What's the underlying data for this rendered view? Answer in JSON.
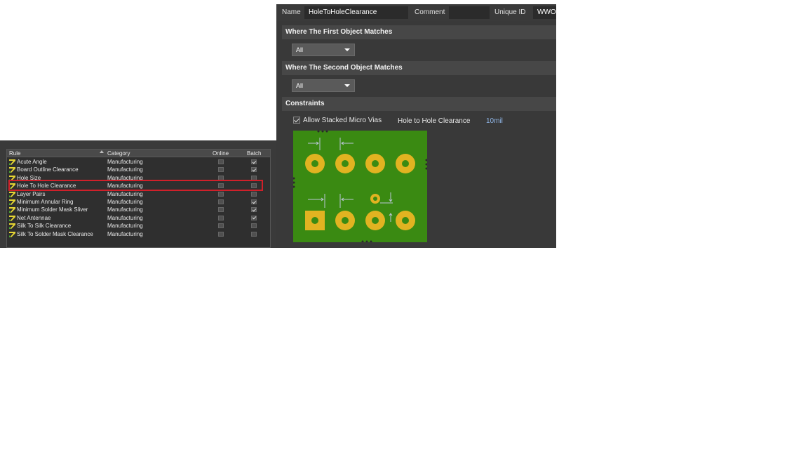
{
  "editor": {
    "name_label": "Name",
    "name_value": "HoleToHoleClearance",
    "comment_label": "Comment",
    "comment_value": "",
    "unique_id_label": "Unique ID",
    "unique_id_value": "WWO",
    "first_match_title": "Where The First Object Matches",
    "first_match_value": "All",
    "second_match_title": "Where The Second Object Matches",
    "second_match_value": "All",
    "constraints_title": "Constraints",
    "allow_stacked_label": "Allow Stacked Micro Vias",
    "allow_stacked_checked": true,
    "hole_clearance_label": "Hole to Hole Clearance",
    "hole_clearance_value": "10mil",
    "colors": {
      "board": "#3a8a12",
      "pad": "#e1b321",
      "arrow": "#b9c6d6",
      "value": "#8fb5e6"
    }
  },
  "rules": {
    "columns": {
      "rule": "Rule",
      "category": "Category",
      "online": "Online",
      "batch": "Batch"
    },
    "rows": [
      {
        "name": "Acute Angle",
        "category": "Manufacturing",
        "online": false,
        "batch": true
      },
      {
        "name": "Board Outline Clearance",
        "category": "Manufacturing",
        "online": false,
        "batch": true
      },
      {
        "name": "Hole Size",
        "category": "Manufacturing",
        "online": false,
        "batch": false
      },
      {
        "name": "Hole To Hole Clearance",
        "category": "Manufacturing",
        "online": false,
        "batch": false,
        "selected": true
      },
      {
        "name": "Layer Pairs",
        "category": "Manufacturing",
        "online": false,
        "batch": false
      },
      {
        "name": "Minimum Annular Ring",
        "category": "Manufacturing",
        "online": false,
        "batch": true
      },
      {
        "name": "Minimum Solder Mask Sliver",
        "category": "Manufacturing",
        "online": false,
        "batch": true
      },
      {
        "name": "Net Antennae",
        "category": "Manufacturing",
        "online": false,
        "batch": true
      },
      {
        "name": "Silk To Silk Clearance",
        "category": "Manufacturing",
        "online": false,
        "batch": false
      },
      {
        "name": "Silk To Solder Mask Clearance",
        "category": "Manufacturing",
        "online": false,
        "batch": false
      }
    ],
    "highlight_color": "#d0202a",
    "icon": "rule-icon"
  }
}
